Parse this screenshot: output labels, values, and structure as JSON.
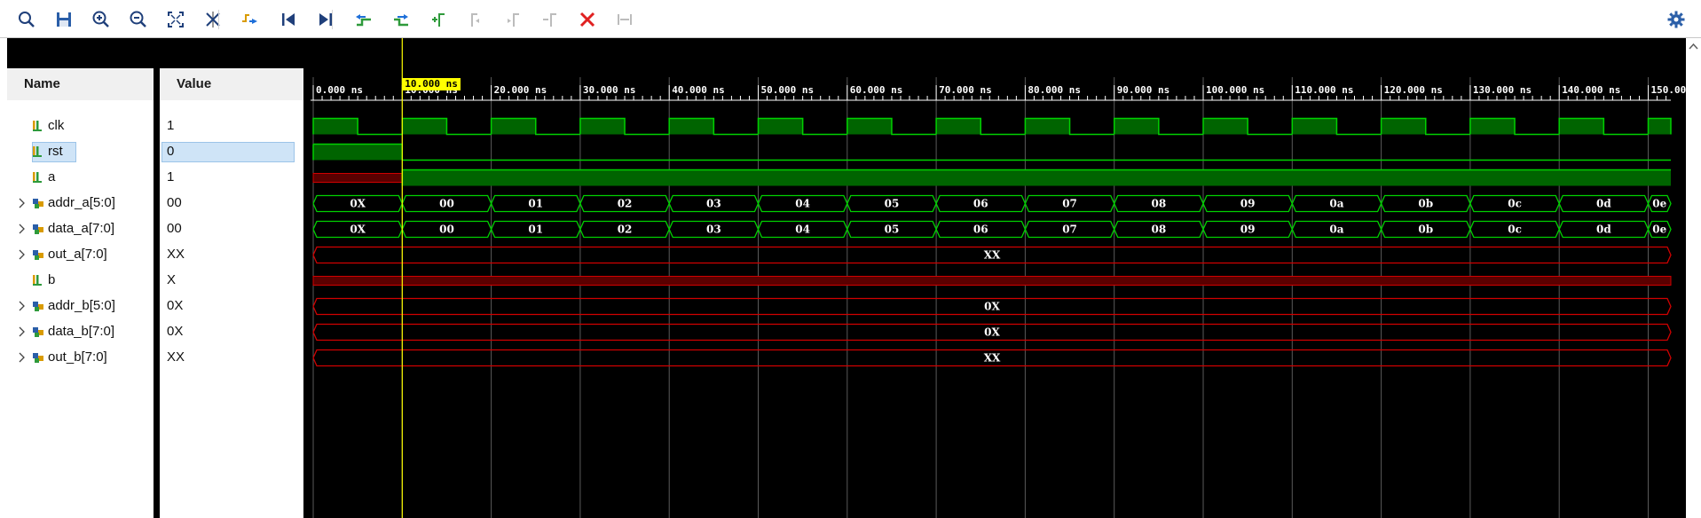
{
  "toolbar": {
    "buttons": [
      {
        "name": "search-icon",
        "enabled": true
      },
      {
        "name": "save-icon",
        "enabled": true
      },
      {
        "name": "zoom-in-icon",
        "enabled": true
      },
      {
        "name": "zoom-out-icon",
        "enabled": true
      },
      {
        "name": "zoom-fit-icon",
        "enabled": true
      },
      {
        "name": "go-to-cursor-icon",
        "enabled": true
      },
      {
        "name": "previous-transition-icon",
        "enabled": true
      },
      {
        "name": "go-to-start-icon",
        "enabled": true
      },
      {
        "name": "go-to-end-icon",
        "enabled": true
      },
      {
        "name": "swap-cursor-left-icon",
        "enabled": true
      },
      {
        "name": "swap-cursor-right-icon",
        "enabled": true
      },
      {
        "name": "add-marker-icon",
        "enabled": true
      },
      {
        "name": "previous-marker-icon",
        "enabled": false
      },
      {
        "name": "next-marker-icon",
        "enabled": false
      },
      {
        "name": "delete-marker-icon",
        "enabled": false
      },
      {
        "name": "delete-all-markers-icon",
        "enabled": true
      },
      {
        "name": "snap-to-transition-icon",
        "enabled": false
      }
    ],
    "settings_icon": "gear-icon"
  },
  "columns": {
    "name_header": "Name",
    "value_header": "Value"
  },
  "cursor": {
    "time_ns": 10,
    "label": "10.000 ns"
  },
  "timeline": {
    "tick_labels": [
      "0.000 ns",
      "10.000 ns",
      "20.000 ns",
      "30.000 ns",
      "40.000 ns",
      "50.000 ns",
      "60.000 ns",
      "70.000 ns",
      "80.000 ns",
      "90.000 ns",
      "100.000 ns",
      "110.000 ns",
      "120.000 ns",
      "130.000 ns",
      "140.000 ns",
      "150.000"
    ]
  },
  "signals": [
    {
      "name": "clk",
      "value": "1",
      "kind": "bit",
      "expandable": false,
      "selected": false,
      "wave": {
        "type": "clock",
        "period_ns": 10,
        "high_first_ns": 5
      }
    },
    {
      "name": "rst",
      "value": "0",
      "kind": "bit",
      "expandable": false,
      "selected": true,
      "wave": {
        "type": "bit",
        "segments": [
          {
            "from": 0,
            "to": 10,
            "level": "1"
          },
          {
            "from": 10,
            "to": 155,
            "level": "0"
          }
        ]
      }
    },
    {
      "name": "a",
      "value": "1",
      "kind": "bit",
      "expandable": false,
      "selected": false,
      "wave": {
        "type": "bit",
        "segments": [
          {
            "from": 0,
            "to": 10,
            "level": "x"
          },
          {
            "from": 10,
            "to": 155,
            "level": "1"
          }
        ]
      }
    },
    {
      "name": "addr_a[5:0]",
      "value": "00",
      "kind": "bus",
      "expandable": true,
      "selected": false,
      "wave": {
        "type": "bus",
        "color": "green",
        "start_labels": [
          "0X",
          "00",
          "01",
          "02",
          "03",
          "04",
          "05",
          "06",
          "07",
          "08",
          "09",
          "0a",
          "0b",
          "0c",
          "0d",
          "0e"
        ],
        "period_ns": 10
      }
    },
    {
      "name": "data_a[7:0]",
      "value": "00",
      "kind": "bus",
      "expandable": true,
      "selected": false,
      "wave": {
        "type": "bus",
        "color": "green",
        "start_labels": [
          "0X",
          "00",
          "01",
          "02",
          "03",
          "04",
          "05",
          "06",
          "07",
          "08",
          "09",
          "0a",
          "0b",
          "0c",
          "0d",
          "0e"
        ],
        "period_ns": 10
      }
    },
    {
      "name": "out_a[7:0]",
      "value": "XX",
      "kind": "bus",
      "expandable": true,
      "selected": false,
      "wave": {
        "type": "bus",
        "color": "red",
        "start_labels": [
          "XX"
        ],
        "period_ns": 155
      }
    },
    {
      "name": "b",
      "value": "X",
      "kind": "bit",
      "expandable": false,
      "selected": false,
      "wave": {
        "type": "bit",
        "segments": [
          {
            "from": 0,
            "to": 155,
            "level": "x"
          }
        ]
      }
    },
    {
      "name": "addr_b[5:0]",
      "value": "0X",
      "kind": "bus",
      "expandable": true,
      "selected": false,
      "wave": {
        "type": "bus",
        "color": "red",
        "start_labels": [
          "0X"
        ],
        "period_ns": 155
      }
    },
    {
      "name": "data_b[7:0]",
      "value": "0X",
      "kind": "bus",
      "expandable": true,
      "selected": false,
      "wave": {
        "type": "bus",
        "color": "red",
        "start_labels": [
          "0X"
        ],
        "period_ns": 155
      }
    },
    {
      "name": "out_b[7:0]",
      "value": "XX",
      "kind": "bus",
      "expandable": true,
      "selected": false,
      "wave": {
        "type": "bus",
        "color": "red",
        "start_labels": [
          "XX"
        ],
        "period_ns": 155
      }
    }
  ],
  "colors": {
    "wave_green": "#00d000",
    "wave_green_fill": "#006400",
    "wave_red": "#d00000",
    "wave_red_fill": "#5a0000",
    "cursor": "#ffff00",
    "grid": "#5a5a5a",
    "tick": "#ffffff",
    "background": "#000000",
    "accent_blue": "#1e6fd9"
  }
}
